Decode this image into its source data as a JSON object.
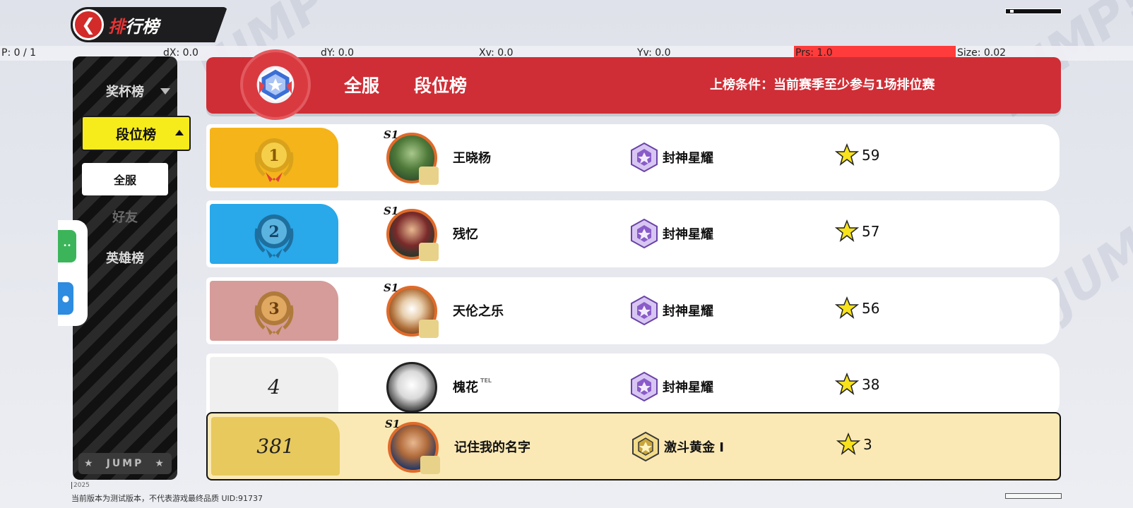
{
  "title": {
    "first_char": "排",
    "rest": "行榜",
    "back_icon": "back-arrow-icon"
  },
  "debug": {
    "p": "P: 0 / 1",
    "dx": "dX: 0.0",
    "dy": "dY: 0.0",
    "xv": "Xv: 0.0",
    "yv": "Yv: 0.0",
    "prs": "Prs: 1.0",
    "size": "Size: 0.02"
  },
  "sidebar": {
    "trophy": "奖杯榜",
    "active": "段位榜",
    "sub_all": "全服",
    "friends": "好友",
    "heroes": "英雄榜",
    "footer": [
      "★",
      "JUMP",
      "★"
    ]
  },
  "banner": {
    "scope": "全服",
    "board": "段位榜",
    "condition": "上榜条件：当前赛季至少参与1场排位赛"
  },
  "rows": [
    {
      "rank": "1",
      "name": "王晓杨",
      "tier": "封神星耀",
      "stars": "59",
      "season": "S1",
      "rank_color": "#f4b41a"
    },
    {
      "rank": "2",
      "name": "残忆",
      "tier": "封神星耀",
      "stars": "57",
      "season": "S1",
      "rank_color": "#29a8ea"
    },
    {
      "rank": "3",
      "name": "天伦之乐",
      "tier": "封神星耀",
      "stars": "56",
      "season": "S1",
      "rank_color": "#d59c9a"
    },
    {
      "rank": "4",
      "name": "槐花",
      "name_tag": "TEL",
      "tier": "封神星耀",
      "stars": "38",
      "season": "",
      "rank_color": "#efefef"
    }
  ],
  "me": {
    "rank": "381",
    "name": "记住我的名字",
    "tier": "激斗黄金 I",
    "stars": "3",
    "season": "S1"
  },
  "footer": {
    "year": "2025",
    "notice": "当前版本为测试版本，不代表游戏最终品质  UID:91737"
  },
  "colors": {
    "accent_red": "#cf2e36",
    "active_yellow": "#f6ec1b",
    "star_yellow": "#f7e21c",
    "tier_purple": "#8a5cc9"
  }
}
